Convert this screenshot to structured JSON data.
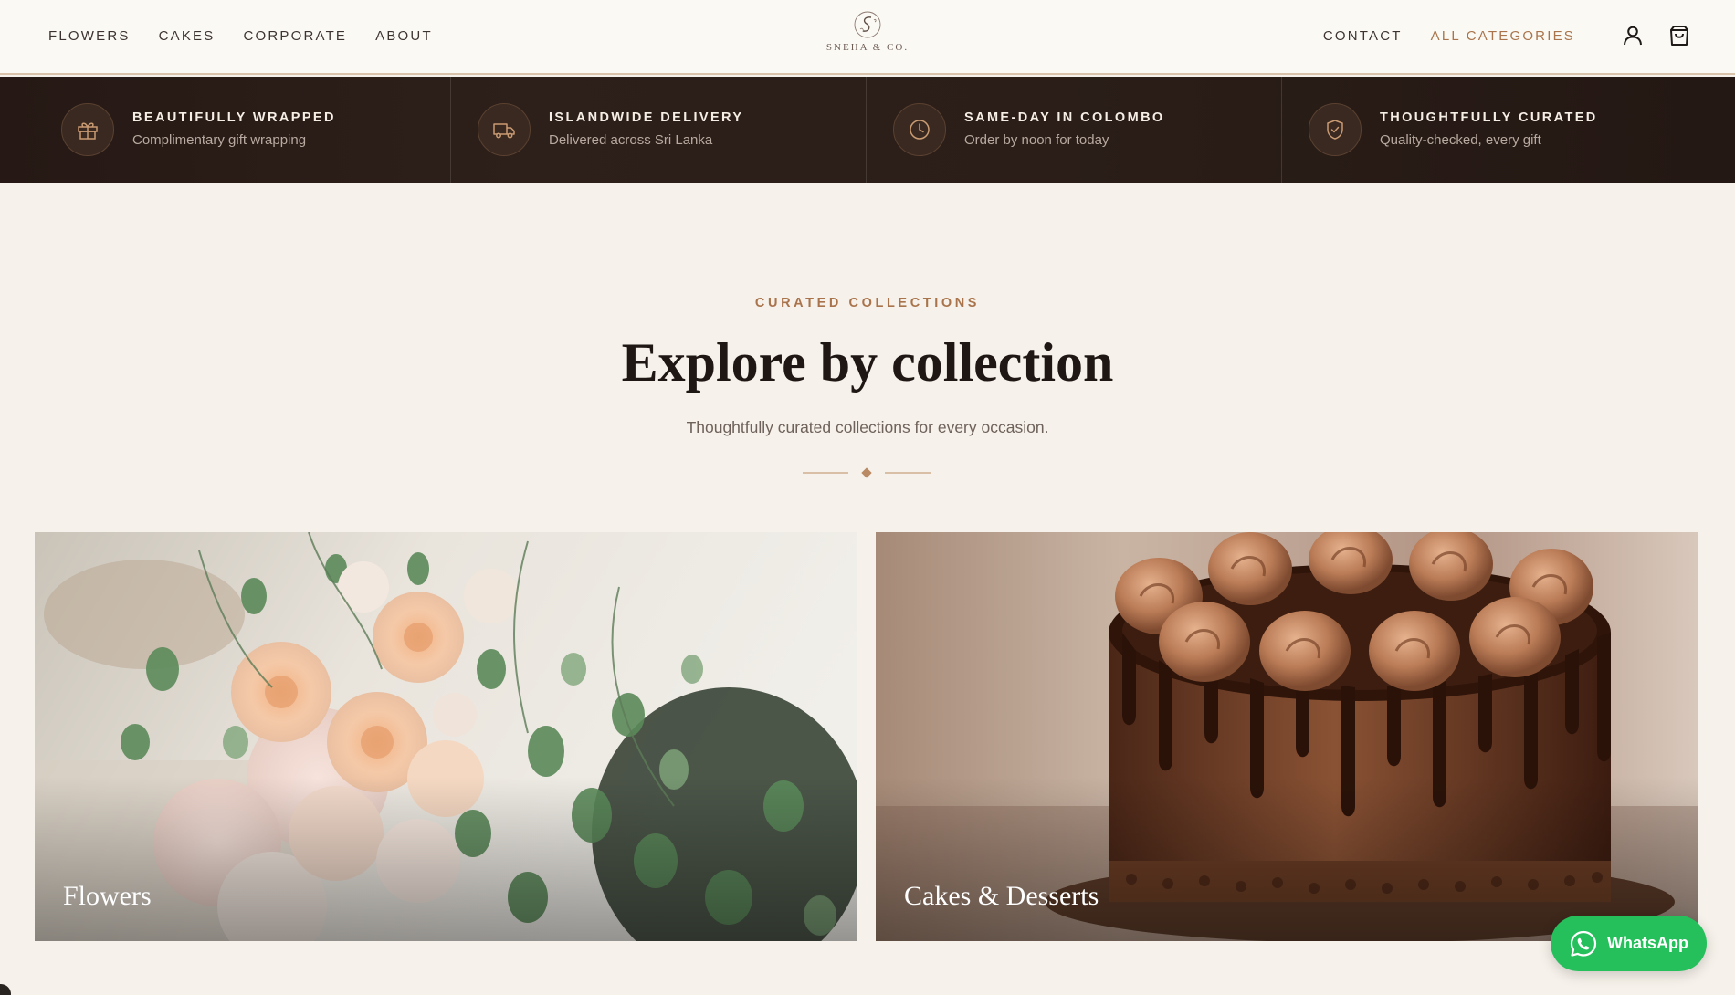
{
  "header": {
    "nav_left": [
      "FLOWERS",
      "CAKES",
      "CORPORATE",
      "ABOUT"
    ],
    "logo_text": "SNEHA & CO.",
    "nav_right": [
      "CONTACT",
      "ALL CATEGORIES"
    ],
    "icons": [
      "account-icon",
      "shopping-bag-icon"
    ]
  },
  "features": [
    {
      "icon": "gift-icon",
      "title": "BEAUTIFULLY WRAPPED",
      "subtitle": "Complimentary gift wrapping"
    },
    {
      "icon": "truck-icon",
      "title": "ISLANDWIDE DELIVERY",
      "subtitle": "Delivered across Sri Lanka"
    },
    {
      "icon": "clock-icon",
      "title": "SAME-DAY IN COLOMBO",
      "subtitle": "Order by noon for today"
    },
    {
      "icon": "shield-check-icon",
      "title": "THOUGHTFULLY CURATED",
      "subtitle": "Quality-checked, every gift"
    }
  ],
  "section": {
    "eyebrow": "CURATED COLLECTIONS",
    "title": "Explore by collection",
    "subtitle": "Thoughtfully curated collections for every occasion."
  },
  "collections": [
    {
      "label": "Flowers"
    },
    {
      "label": "Cakes & Desserts"
    }
  ],
  "whatsapp": {
    "label": "WhatsApp"
  },
  "colors": {
    "accent": "#a9744b",
    "dark_strip": "#2a1d17",
    "page_bg": "#f6f1ea",
    "whatsapp_green": "#25c05b"
  }
}
